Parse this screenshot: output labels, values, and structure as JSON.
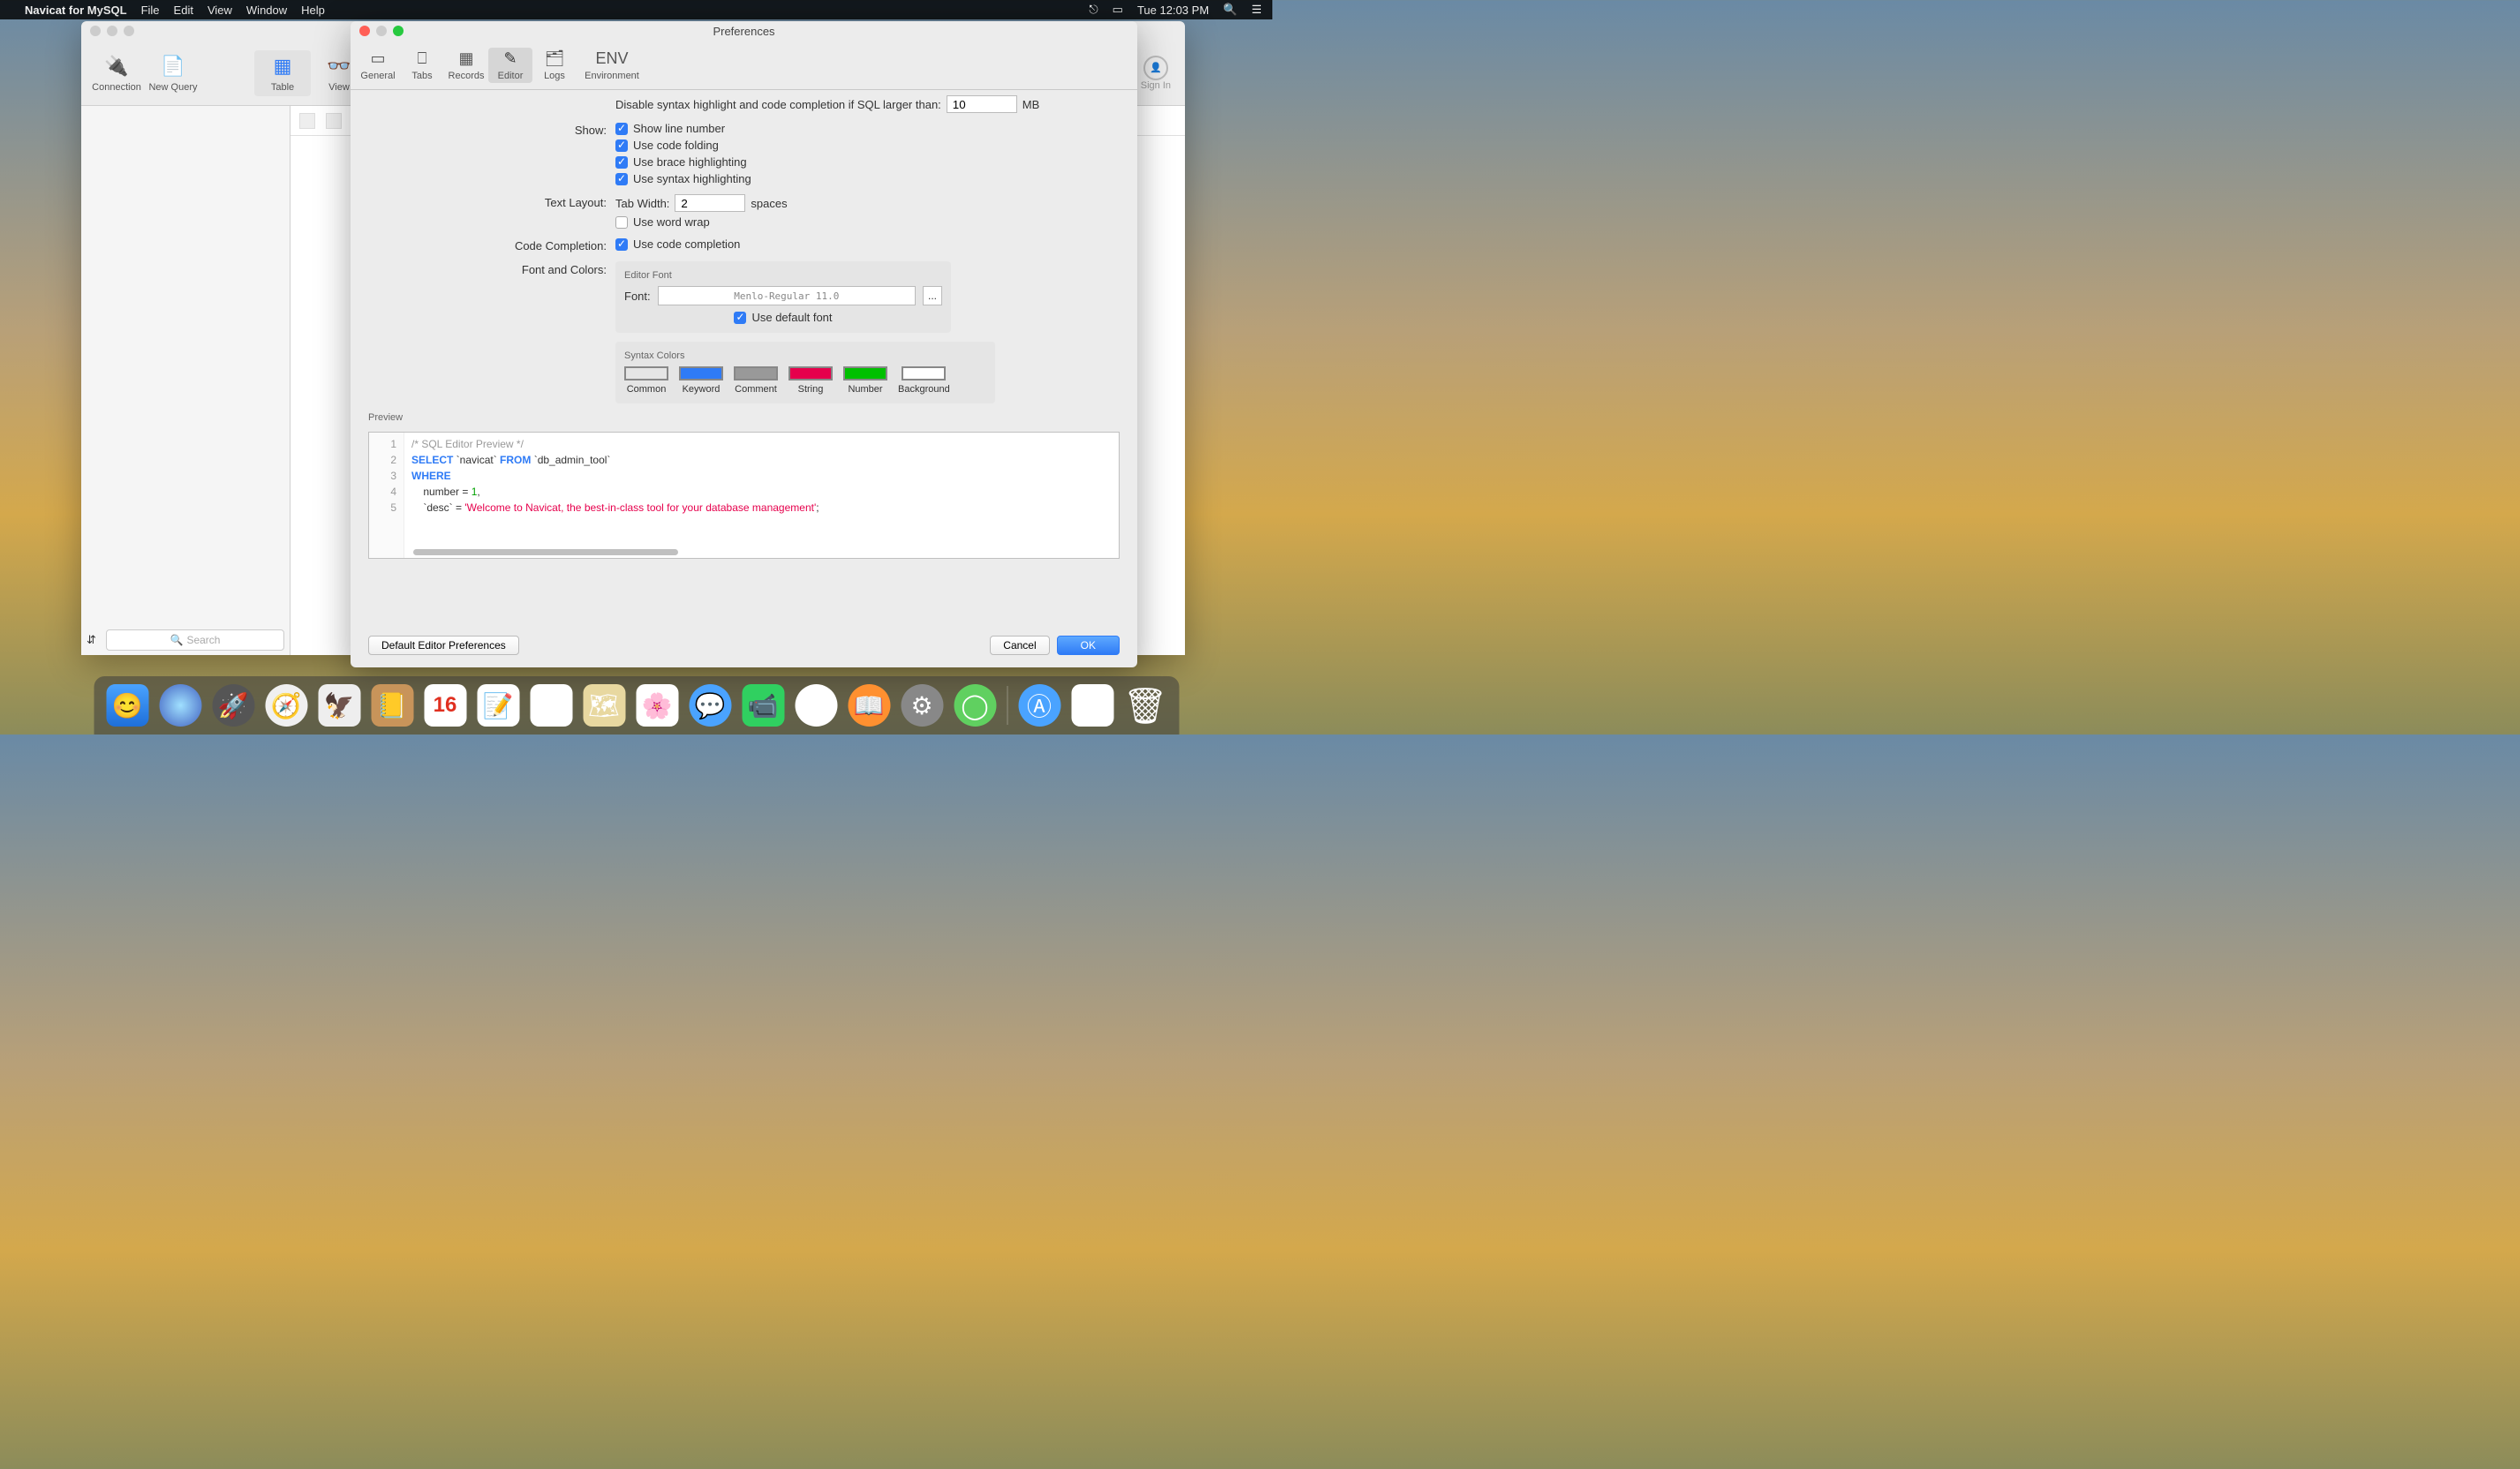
{
  "menubar": {
    "app": "Navicat for MySQL",
    "items": [
      "File",
      "Edit",
      "View",
      "Window",
      "Help"
    ],
    "clock": "Tue 12:03 PM"
  },
  "nav": {
    "toolbar": {
      "connection": "Connection",
      "newquery": "New Query",
      "table": "Table",
      "view": "View"
    },
    "signin": "Sign In",
    "search_placeholder": "Search"
  },
  "pref": {
    "title": "Preferences",
    "tabs": {
      "general": "General",
      "tabs": "Tabs",
      "records": "Records",
      "editor": "Editor",
      "logs": "Logs",
      "env": "Environment"
    },
    "disable_label": "Disable syntax highlight and code completion if SQL larger than:",
    "disable_value": "10",
    "disable_unit": "MB",
    "show_label": "Show:",
    "chk_line": "Show line number",
    "chk_fold": "Use code folding",
    "chk_brace": "Use brace highlighting",
    "chk_syntax": "Use syntax highlighting",
    "textlayout_label": "Text Layout:",
    "tabwidth_label": "Tab Width:",
    "tabwidth_value": "2",
    "spaces": "spaces",
    "chk_wrap": "Use word wrap",
    "completion_label": "Code Completion:",
    "chk_completion": "Use code completion",
    "fontcolors_label": "Font and Colors:",
    "editorfont": "Editor Font",
    "font_l": "Font:",
    "font_name": "Menlo-Regular 11.0",
    "chk_deffont": "Use default font",
    "syntaxcolors": "Syntax Colors",
    "swatches": {
      "common": {
        "label": "Common",
        "color": "#444444"
      },
      "keyword": {
        "label": "Keyword",
        "color": "#2f7bf6"
      },
      "comment": {
        "label": "Comment",
        "color": "#999999"
      },
      "string": {
        "label": "String",
        "color": "#e6004c"
      },
      "number": {
        "label": "Number",
        "color": "#00c000"
      },
      "background": {
        "label": "Background",
        "color": "#ffffff"
      }
    },
    "preview_label": "Preview",
    "code": {
      "l1": "/* SQL Editor Preview */",
      "l2a": "SELECT",
      "l2b": " `navicat` ",
      "l2c": "FROM",
      "l2d": " `db_admin_tool`",
      "l3": "WHERE",
      "l4a": "    number = ",
      "l4b": "1",
      "l4c": ",",
      "l5a": "    `desc` = ",
      "l5b": "'Welcome to Navicat, the best-in-class tool for your database management'",
      "l5c": ";"
    },
    "btn_default": "Default Editor Preferences",
    "btn_cancel": "Cancel",
    "btn_ok": "OK"
  },
  "dock": {
    "cal": "16"
  }
}
